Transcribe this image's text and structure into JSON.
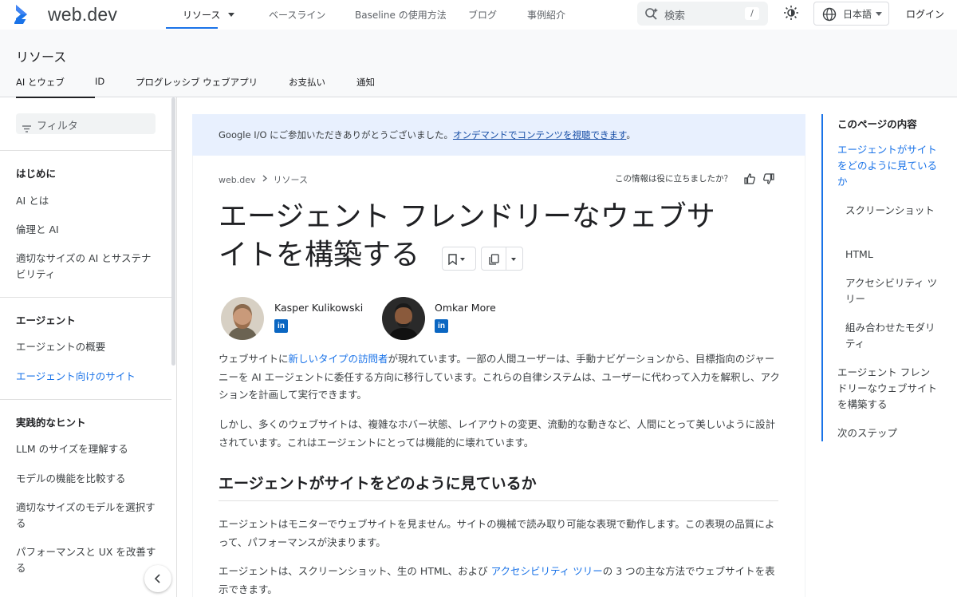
{
  "header": {
    "logo_text": "web.dev",
    "nav": [
      {
        "label": "リソース"
      },
      {
        "label": "ベースライン"
      },
      {
        "label": "Baseline の使用方法"
      },
      {
        "label": "ブログ"
      },
      {
        "label": "事例紹介"
      }
    ],
    "search_placeholder": "検索",
    "search_shortcut": "/",
    "language": "日本語",
    "login": "ログイン"
  },
  "section": {
    "title": "リソース",
    "tabs": [
      {
        "label": "AI とウェブ"
      },
      {
        "label": "ID"
      },
      {
        "label": "プログレッシブ ウェブアプリ"
      },
      {
        "label": "お支払い"
      },
      {
        "label": "通知"
      }
    ]
  },
  "sidebar": {
    "filter_placeholder": "フィルタ",
    "groups": [
      {
        "heading": "はじめに",
        "items": [
          "AI とは",
          "倫理と AI",
          "適切なサイズの AI とサステナビリティ"
        ]
      },
      {
        "heading": "エージェント",
        "items": [
          "エージェントの概要",
          "エージェント向けのサイト"
        ]
      },
      {
        "heading": "実践的なヒント",
        "items": [
          "LLM のサイズを理解する",
          "モデルの機能を比較する",
          "適切なサイズのモデルを選択する",
          "パフォーマンスと UX を改善する"
        ]
      }
    ]
  },
  "banner": {
    "text": "Google I/O にご参加いただきありがとうございました。",
    "link": "オンデマンドでコンテンツを視聴できます",
    "suffix": "。"
  },
  "breadcrumb": [
    "web.dev",
    "リソース"
  ],
  "feedback_prompt": "この情報は役に立ちましたか？",
  "article": {
    "title_line1": "エージェント フレンドリーなウェブサ",
    "title_line2": "イトを構築する",
    "authors": [
      {
        "name": "Kasper Kulikowski"
      },
      {
        "name": "Omkar More"
      }
    ],
    "linkedin_glyph": "in",
    "p1_pre": "ウェブサイトに",
    "p1_link": "新しいタイプの訪問者",
    "p1_post": "が現れています。一部の人間ユーザーは、手動ナビゲーションから、目標指向のジャーニーを AI エージェントに委任する方向に移行しています。これらの自律システムは、ユーザーに代わって入力を解釈し、アクションを計画して実行できます。",
    "p2": "しかし、多くのウェブサイトは、複雑なホバー状態、レイアウトの変更、流動的な動きなど、人間にとって美しいように設計されています。これはエージェントにとっては機能的に壊れています。",
    "h2": "エージェントがサイトをどのように見ているか",
    "p3": "エージェントはモニターでウェブサイトを見ません。サイトの機械で読み取り可能な表現で動作します。この表現の品質によって、パフォーマンスが決まります。",
    "p4_pre": "エージェントは、スクリーンショット、生の HTML、および ",
    "p4_link": "アクセシビリティ ツリー",
    "p4_post": "の 3 つの主な方法でウェブサイトを表示できます。"
  },
  "toc": {
    "title": "このページの内容",
    "items": [
      "エージェントがサイトをどのように見ているか",
      "スクリーンショット",
      "HTML",
      "アクセシビリティ ツリー",
      "組み合わせたモダリティ",
      "エージェント フレンドリーなウェブサイトを構築する",
      "次のステップ"
    ]
  },
  "colors": {
    "accent": "#1a73e8",
    "banner_bg": "#e8f0fe",
    "section_bg": "#f8f9fa"
  }
}
